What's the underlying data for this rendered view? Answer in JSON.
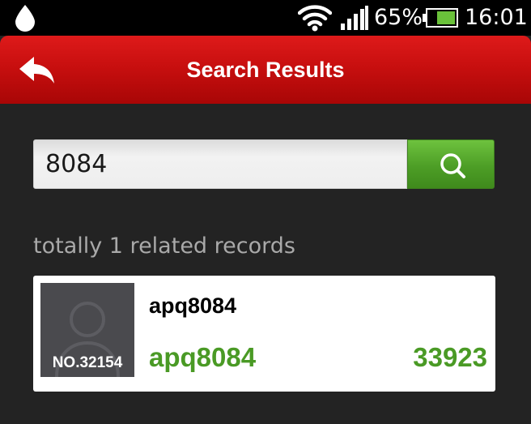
{
  "status_bar": {
    "battery_percent": "65%",
    "time": "16:01",
    "icons": [
      "water-drop-icon",
      "wifi-icon",
      "signal-icon",
      "battery-icon"
    ]
  },
  "header": {
    "title": "Search Results",
    "back_icon": "back-arrow-icon"
  },
  "search": {
    "value": "8084",
    "button_icon": "search-icon"
  },
  "summary": "totally 1 related records",
  "results": [
    {
      "rank": "NO.32154",
      "title": "apq8084",
      "name": "apq8084",
      "score": "33923"
    }
  ],
  "colors": {
    "header_red": "#c80f0f",
    "accent_green": "#4a9a25",
    "background": "#232323"
  }
}
